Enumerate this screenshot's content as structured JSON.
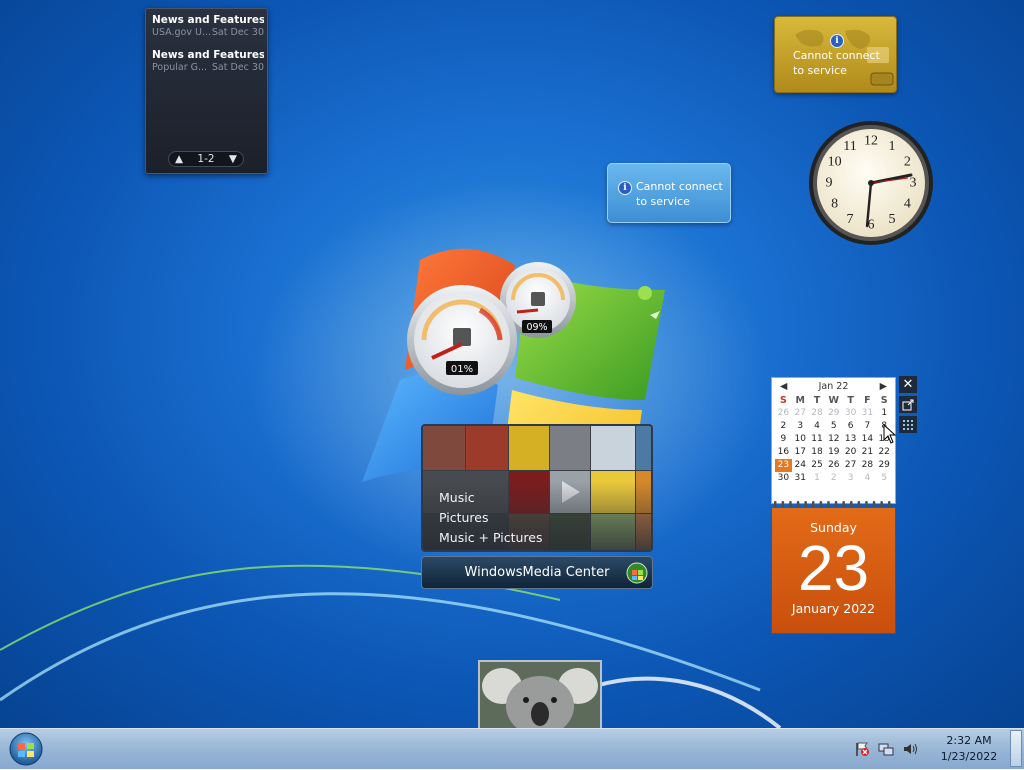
{
  "feed": {
    "items": [
      {
        "title": "News and Features f...",
        "source": "USA.gov U...",
        "date": "Sat Dec 30"
      },
      {
        "title": "News and Features f...",
        "source": "Popular G...",
        "date": "Sat Dec 30"
      }
    ],
    "pager": "1-2"
  },
  "currency": {
    "message_line1": "Cannot connect",
    "message_line2": "to service",
    "icon": "info-icon"
  },
  "weather": {
    "message_line1": "Cannot connect",
    "message_line2": "to service",
    "icon": "info-icon"
  },
  "clock": {
    "numerals": [
      "12",
      "1",
      "2",
      "3",
      "4",
      "5",
      "6",
      "7",
      "8",
      "9",
      "10",
      "11"
    ]
  },
  "cpu_meter": {
    "cpu_label": "01%",
    "memory_label": "09%"
  },
  "media_center": {
    "menu": [
      "Music",
      "Pictures",
      "Music + Pictures"
    ],
    "brand_prefix": "Windows",
    "brand_suffix": " Media Center"
  },
  "calendar": {
    "month_header": "Jan 22",
    "weekdays": [
      "S",
      "M",
      "T",
      "W",
      "T",
      "F",
      "S"
    ],
    "weeks": [
      [
        "26",
        "27",
        "28",
        "29",
        "30",
        "31",
        "1"
      ],
      [
        "2",
        "3",
        "4",
        "5",
        "6",
        "7",
        "8"
      ],
      [
        "9",
        "10",
        "11",
        "12",
        "13",
        "14",
        "15"
      ],
      [
        "16",
        "17",
        "18",
        "19",
        "20",
        "21",
        "22"
      ],
      [
        "23",
        "24",
        "25",
        "26",
        "27",
        "28",
        "29"
      ],
      [
        "30",
        "31",
        "1",
        "2",
        "3",
        "4",
        "5"
      ]
    ],
    "today": "23",
    "day_name": "Sunday",
    "day_number": "23",
    "month_year": "January 2022"
  },
  "taskbar": {
    "time": "2:32 AM",
    "date": "1/23/2022"
  },
  "colors": {
    "calendar_accent": "#e87722",
    "currency_gold": "#c9a42c",
    "taskbar": "#a5c1de"
  }
}
